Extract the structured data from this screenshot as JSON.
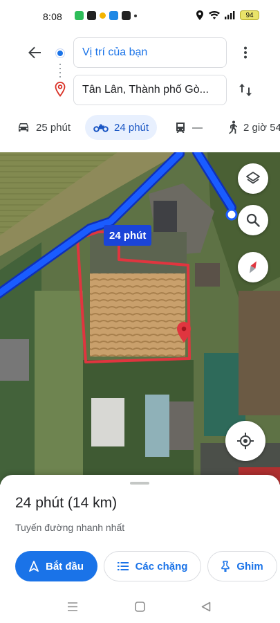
{
  "status_bar": {
    "time": "8:08",
    "battery": "94"
  },
  "route": {
    "origin": "Vị trí của bạn",
    "destination": "Tân Lân, Thành phố Gò..."
  },
  "modes": [
    {
      "icon": "car-icon",
      "label": "25 phút"
    },
    {
      "icon": "motorbike-icon",
      "label": "24 phút",
      "active": true
    },
    {
      "icon": "transit-icon",
      "label": "—"
    },
    {
      "icon": "walk-icon",
      "label": "2 giờ 54"
    }
  ],
  "map": {
    "duration_chip": "24 phút",
    "route_color": "#1a44d8",
    "boundary_color": "#e0353f"
  },
  "sheet": {
    "summary": "24 phút (14 km)",
    "subtitle": "Tuyến đường nhanh nhất",
    "start_label": "Bắt đầu",
    "steps_label": "Các chặng",
    "pin_label": "Ghim"
  },
  "colors": {
    "accent": "#1a73e8",
    "chip_bg": "#e8f0fe"
  }
}
